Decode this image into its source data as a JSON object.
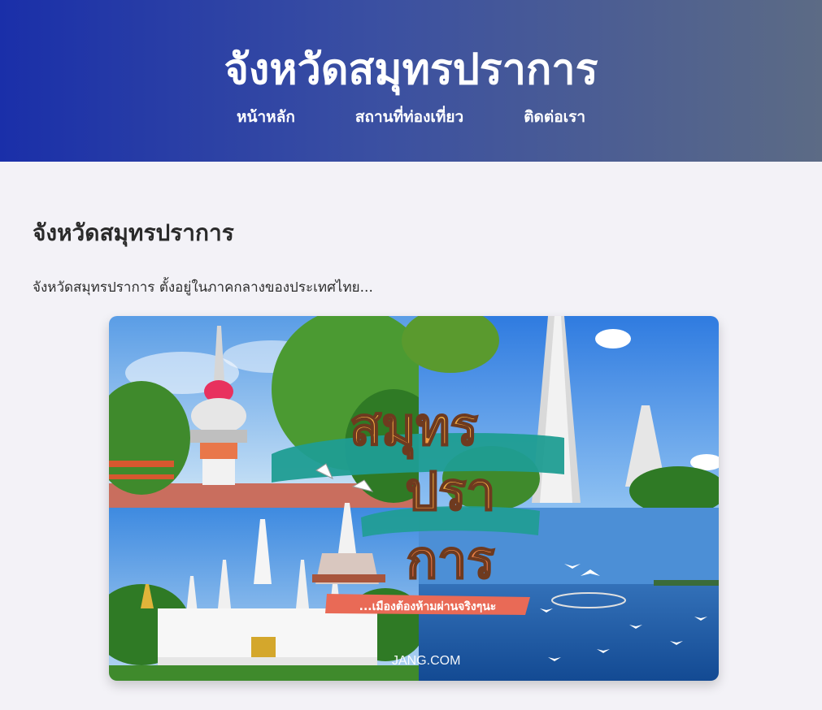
{
  "header": {
    "title": "จังหวัดสมุทรปราการ",
    "nav": [
      {
        "label": "หน้าหลัก"
      },
      {
        "label": "สถานที่ท่องเที่ยว"
      },
      {
        "label": "ติดต่อเรา"
      }
    ]
  },
  "main": {
    "heading": "จังหวัดสมุทรปราการ",
    "intro": "จังหวัดสมุทรปราการ ตั้งอยู่ในภาคกลางของประเทศไทย...",
    "hero_image": {
      "big_text_line1": "สมุทร",
      "big_text_line2": "ปรา",
      "big_text_line3": "การ",
      "ribbon_text": "...เมืองต้องห้ามผ่านจริงๆนะ",
      "watermark": "JANG.COM"
    }
  },
  "colors": {
    "header_start": "#1a2fa9",
    "header_end": "#5c6b85",
    "page_bg": "#f3f2f7",
    "ribbon": "#e96a56",
    "title_yellow": "#f6c94a",
    "title_orange": "#ef8a3c"
  }
}
